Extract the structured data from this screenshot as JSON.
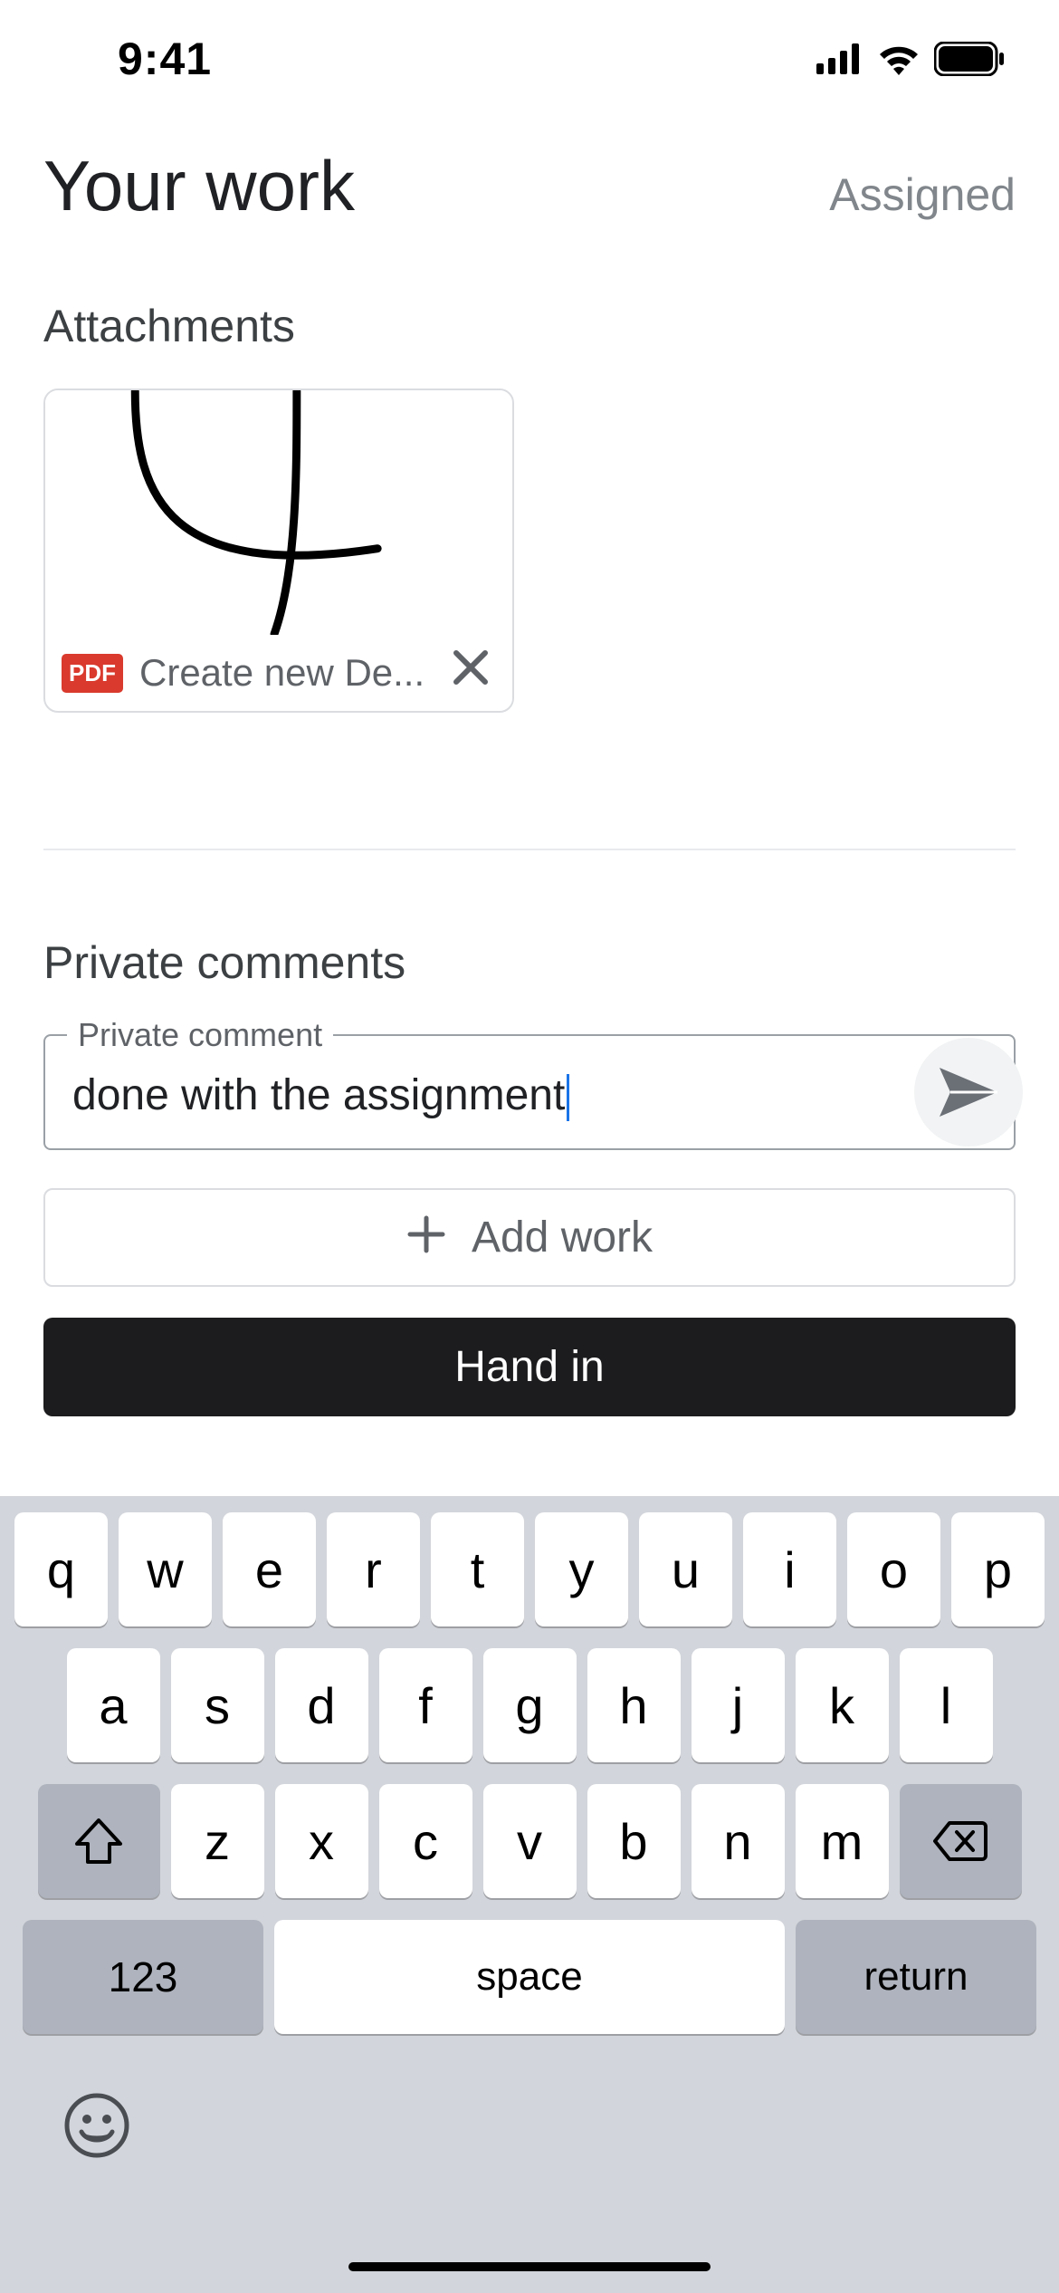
{
  "statusBar": {
    "time": "9:41"
  },
  "header": {
    "title": "Your work",
    "status": "Assigned"
  },
  "attachments": {
    "sectionTitle": "Attachments",
    "item": {
      "badge": "PDF",
      "name": "Create new De..."
    }
  },
  "comments": {
    "sectionTitle": "Private comments",
    "legend": "Private comment",
    "value": "done with the assignment"
  },
  "buttons": {
    "addWork": "Add work",
    "handIn": "Hand in"
  },
  "keyboard": {
    "row1": [
      "q",
      "w",
      "e",
      "r",
      "t",
      "y",
      "u",
      "i",
      "o",
      "p"
    ],
    "row2": [
      "a",
      "s",
      "d",
      "f",
      "g",
      "h",
      "j",
      "k",
      "l"
    ],
    "row3": [
      "z",
      "x",
      "c",
      "v",
      "b",
      "n",
      "m"
    ],
    "numKey": "123",
    "spaceKey": "space",
    "returnKey": "return"
  }
}
